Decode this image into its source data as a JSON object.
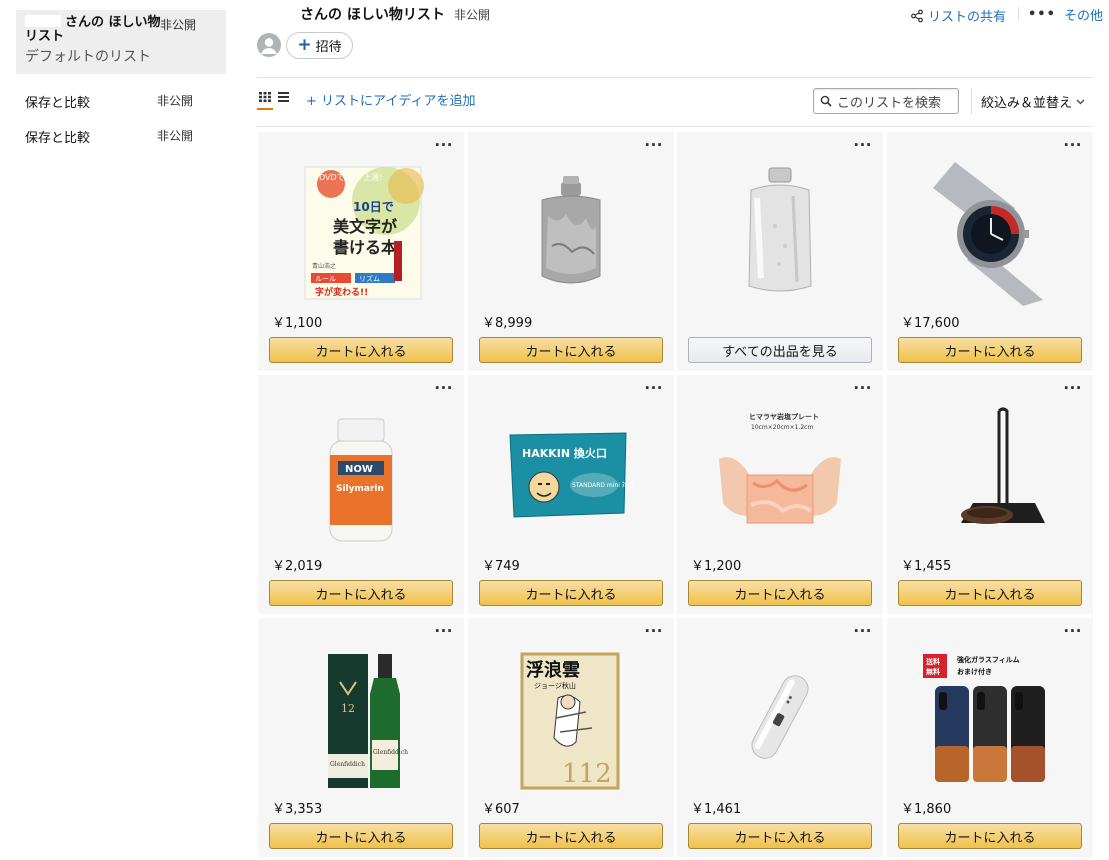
{
  "sidebar": {
    "current_list": {
      "title": "さんの ほしい物リスト",
      "privacy": "非公開",
      "subtitle": "デフォルトのリスト"
    },
    "items": [
      {
        "label": "保存と比較",
        "privacy": "非公開"
      },
      {
        "label": "保存と比較",
        "privacy": "非公開"
      }
    ]
  },
  "header": {
    "title": "さんの ほしい物リスト",
    "privacy": "非公開",
    "invite_label": "招待",
    "share_label": "リストの共有",
    "more_label": "その他",
    "more_dots": "•••"
  },
  "toolbar": {
    "add_idea_label": "+ リストにアイディアを追加",
    "search_placeholder": "このリストを検索",
    "filter_label": "絞込み＆並替え"
  },
  "colors": {
    "accent_link": "#1d6fbf",
    "cart_button": "#f0c14b",
    "active_view": "#e77600"
  },
  "products": [
    {
      "icon": "book-cover-image",
      "price": "￥1,100",
      "button": "カートに入れる",
      "button_style": "primary"
    },
    {
      "icon": "pewter-flask-image",
      "price": "￥8,999",
      "button": "カートに入れる",
      "button_style": "primary"
    },
    {
      "icon": "silver-flask-image",
      "price": "",
      "button": "すべての出品を見る",
      "button_style": "secondary"
    },
    {
      "icon": "wristwatch-image",
      "price": "￥17,600",
      "button": "カートに入れる",
      "button_style": "primary"
    },
    {
      "icon": "supplement-bottle-image",
      "price": "￥2,019",
      "button": "カートに入れる",
      "button_style": "primary"
    },
    {
      "icon": "hakkin-box-image",
      "price": "￥749",
      "button": "カートに入れる",
      "button_style": "primary"
    },
    {
      "icon": "salt-plate-image",
      "price": "￥1,200",
      "button": "カートに入れる",
      "button_style": "primary"
    },
    {
      "icon": "kitchen-stand-image",
      "price": "￥1,455",
      "button": "カートに入れる",
      "button_style": "primary"
    },
    {
      "icon": "whisky-bottle-image",
      "price": "￥3,353",
      "button": "カートに入れる",
      "button_style": "primary"
    },
    {
      "icon": "manga-cover-image",
      "price": "￥607",
      "button": "カートに入れる",
      "button_style": "primary"
    },
    {
      "icon": "power-bank-image",
      "price": "￥1,461",
      "button": "カートに入れる",
      "button_style": "primary"
    },
    {
      "icon": "phone-case-image",
      "price": "￥1,860",
      "button": "カートに入れる",
      "button_style": "primary"
    }
  ],
  "product_image_texts": {
    "book": [
      "DVDで すぐ上達!",
      "10日で",
      "美文字が",
      "書ける本",
      "青山浩之",
      "ルール",
      "リズム",
      "字が変わる!!"
    ],
    "hakkin": [
      "HAKKIN 換火口",
      "STANDARD mini 対応"
    ],
    "salt": [
      "ヒマラヤ岩塩プレート",
      "10cm×20cm×1.2cm"
    ],
    "supplement": [
      "NOW",
      "Silymarin"
    ],
    "whisky": [
      "12",
      "Glenfiddich"
    ],
    "manga": [
      "浮浪雲",
      "ジョージ秋山",
      "112"
    ],
    "phone": [
      "送料 無料",
      "強化ガラスフィルム",
      "おまけ付き"
    ]
  }
}
